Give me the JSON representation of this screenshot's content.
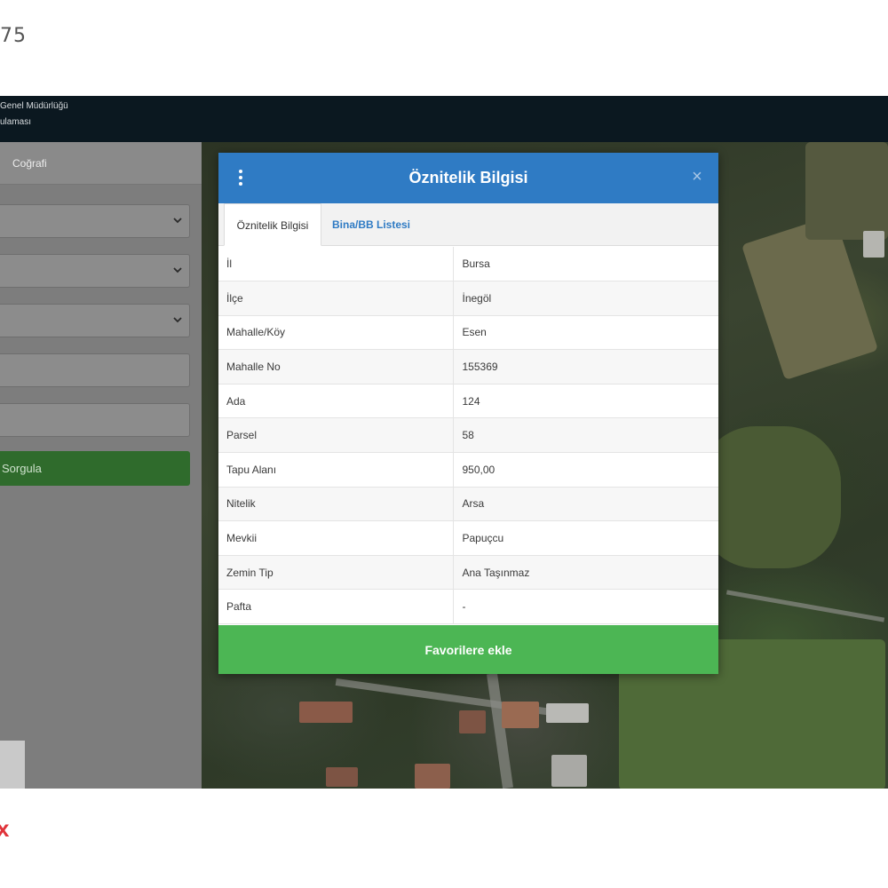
{
  "page": {
    "number_fragment": "75",
    "corner_mark": "x"
  },
  "header": {
    "line1": "Genel Müdürlüğü",
    "line2": "ulaması"
  },
  "sidebar": {
    "tab_label": "Coğrafi",
    "query_button": "Sorgula"
  },
  "modal": {
    "title": "Öznitelik Bilgisi",
    "tabs": [
      {
        "label": "Öznitelik Bilgisi",
        "active": true
      },
      {
        "label": "Bina/BB Listesi",
        "active": false
      }
    ],
    "rows": [
      {
        "key": "İl",
        "value": "Bursa"
      },
      {
        "key": "İlçe",
        "value": "İnegöl"
      },
      {
        "key": "Mahalle/Köy",
        "value": "Esen"
      },
      {
        "key": "Mahalle No",
        "value": "155369"
      },
      {
        "key": "Ada",
        "value": "124"
      },
      {
        "key": "Parsel",
        "value": "58"
      },
      {
        "key": "Tapu Alanı",
        "value": "950,00"
      },
      {
        "key": "Nitelik",
        "value": "Arsa"
      },
      {
        "key": "Mevkii",
        "value": "Papuçcu"
      },
      {
        "key": "Zemin Tip",
        "value": "Ana Taşınmaz"
      },
      {
        "key": "Pafta",
        "value": "-"
      }
    ],
    "favorite_button": "Favorilere ekle"
  },
  "colors": {
    "header_bg": "#0b1820",
    "modal_header": "#2f7bc4",
    "favorite_button": "#4cb654",
    "query_button": "#2f6b2c",
    "sidebar_bg": "#7d7d7d"
  },
  "icons": {
    "menu": "kebab-menu-icon",
    "close": "close-icon",
    "chevron": "chevron-down-icon"
  }
}
